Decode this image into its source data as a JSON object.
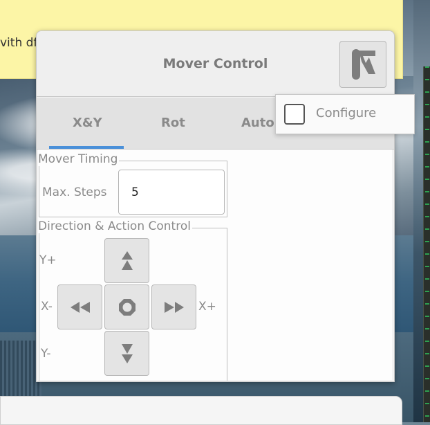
{
  "background": {
    "note_text": "vith df"
  },
  "dialog": {
    "title": "Mover Control",
    "menu_icon": "app-menu-icon",
    "tabs": [
      {
        "label": "X&Y",
        "active": true
      },
      {
        "label": "Rot",
        "active": false
      },
      {
        "label": "Auto",
        "active": false
      }
    ],
    "timing": {
      "frame_label": "Mover Timing",
      "max_steps_label": "Max. Steps",
      "max_steps_value": "5"
    },
    "direction": {
      "frame_label": "Direction & Action Control",
      "y_plus": "Y+",
      "x_minus": "X-",
      "x_plus": "X+",
      "y_minus": "Y-",
      "buttons": {
        "up": "up-arrow-icon",
        "left": "rewind-icon",
        "stop": "stop-icon",
        "right": "fast-forward-icon",
        "down": "down-arrow-icon"
      }
    }
  },
  "popover": {
    "configure_label": "Configure",
    "configure_checked": false
  },
  "colors": {
    "accent": "#4a90d9",
    "note_bg": "#fcf5a6",
    "dialog_bg": "#f3f3f3"
  }
}
